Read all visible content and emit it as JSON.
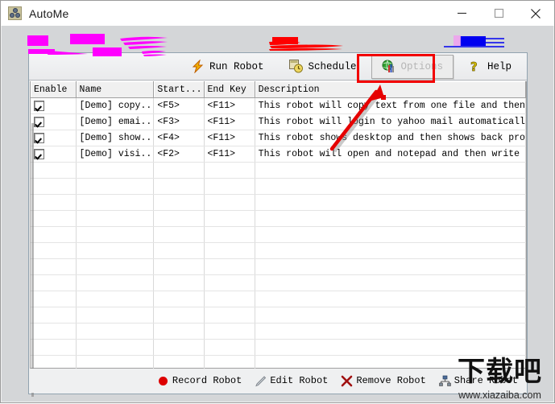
{
  "window": {
    "title": "AutoMe",
    "icon": "autome-app-icon",
    "controls": {
      "minimize": "minimize-icon",
      "maximize": "maximize-icon",
      "close": "close-icon"
    }
  },
  "toolbar": {
    "buttons": [
      {
        "label": "Run Robot",
        "icon": "lightning-bolt-icon",
        "disabled": false
      },
      {
        "label": "Schedule",
        "icon": "clock-calendar-icon",
        "disabled": false
      },
      {
        "label": "Options",
        "icon": "globe-tools-icon",
        "disabled": true
      },
      {
        "label": "Help",
        "icon": "question-mark-icon",
        "disabled": false
      }
    ]
  },
  "list": {
    "columns": [
      "Enable",
      "Name",
      "Start...",
      "End Key",
      "Description"
    ],
    "rows": [
      {
        "enabled": true,
        "name": "[Demo] copy...",
        "start_key": "<F5>",
        "end_key": "<F11>",
        "description": "This robot will copy text from one file and then p..."
      },
      {
        "enabled": true,
        "name": "[Demo] emai...",
        "start_key": "<F3>",
        "end_key": "<F11>",
        "description": "This robot will login to yahoo mail automatically"
      },
      {
        "enabled": true,
        "name": "[Demo] show...",
        "start_key": "<F4>",
        "end_key": "<F11>",
        "description": "This robot shows desktop and then shows back progr..."
      },
      {
        "enabled": true,
        "name": "[Demo] visi...",
        "start_key": "<F2>",
        "end_key": "<F11>",
        "description": "This robot will open and notepad and then write"
      }
    ],
    "empty_row_count": 16
  },
  "bottombar": {
    "buttons": [
      {
        "label": "Record Robot",
        "icon": "red-circle-record-icon"
      },
      {
        "label": "Edit Robot",
        "icon": "pencil-icon"
      },
      {
        "label": "Remove Robot",
        "icon": "x-cross-icon"
      },
      {
        "label": "Share Robot",
        "icon": "share-network-icon"
      }
    ]
  },
  "watermark": {
    "text": "下载吧",
    "url": "www.xiazaiba.com"
  },
  "annotations": {
    "highlight_target": "Options",
    "colors": {
      "highlight": "#f20000",
      "arrow": "#e60000",
      "magenta_scribble": "#ff00ff",
      "red_scribble": "#fe0000",
      "blue_scribble": "#0000f0"
    }
  }
}
